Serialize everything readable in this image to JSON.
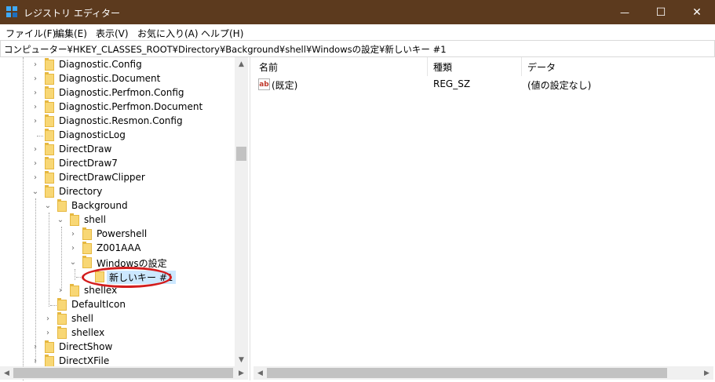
{
  "window": {
    "title": "レジストリ エディター",
    "minimize_glyph": "—",
    "maximize_glyph": "☐",
    "close_glyph": "✕"
  },
  "menu": {
    "items": [
      "ファイル(F)",
      "編集(E)",
      "表示(V)",
      "お気に入り(A)",
      "ヘルプ(H)"
    ]
  },
  "address": {
    "path": "コンピューター¥HKEY_CLASSES_ROOT¥Directory¥Background¥shell¥Windowsの設定¥新しいキー #1"
  },
  "tree": {
    "items": [
      {
        "label": "Diagnostic.Config",
        "expander": "collapsed"
      },
      {
        "label": "Diagnostic.Document",
        "expander": "collapsed"
      },
      {
        "label": "Diagnostic.Perfmon.Config",
        "expander": "collapsed"
      },
      {
        "label": "Diagnostic.Perfmon.Document",
        "expander": "collapsed"
      },
      {
        "label": "Diagnostic.Resmon.Config",
        "expander": "collapsed"
      },
      {
        "label": "DiagnosticLog",
        "expander": "none"
      },
      {
        "label": "DirectDraw",
        "expander": "collapsed"
      },
      {
        "label": "DirectDraw7",
        "expander": "collapsed"
      },
      {
        "label": "DirectDrawClipper",
        "expander": "collapsed"
      },
      {
        "label": "Directory",
        "expander": "expanded"
      },
      {
        "label": "Background",
        "expander": "expanded"
      },
      {
        "label": "shell",
        "expander": "expanded"
      },
      {
        "label": "Powershell",
        "expander": "collapsed"
      },
      {
        "label": "Z001AAA",
        "expander": "collapsed"
      },
      {
        "label": "Windowsの設定",
        "expander": "expanded"
      },
      {
        "label": "新しいキー #1",
        "expander": "none",
        "selected": true
      },
      {
        "label": "shellex",
        "expander": "collapsed"
      },
      {
        "label": "DefaultIcon",
        "expander": "none"
      },
      {
        "label": "shell",
        "expander": "collapsed"
      },
      {
        "label": "shellex",
        "expander": "collapsed"
      },
      {
        "label": "DirectShow",
        "expander": "collapsed"
      },
      {
        "label": "DirectXFile",
        "expander": "collapsed"
      }
    ]
  },
  "values": {
    "columns": {
      "name": "名前",
      "type": "種類",
      "data": "データ"
    },
    "rows": [
      {
        "icon": "ab",
        "name": "(既定)",
        "type": "REG_SZ",
        "data": "(値の設定なし)"
      }
    ]
  },
  "colors": {
    "titlebar": "#5c3a1e",
    "highlight": "#d31d1d",
    "selection": "#cce8ff",
    "folder": "#f8d775"
  }
}
